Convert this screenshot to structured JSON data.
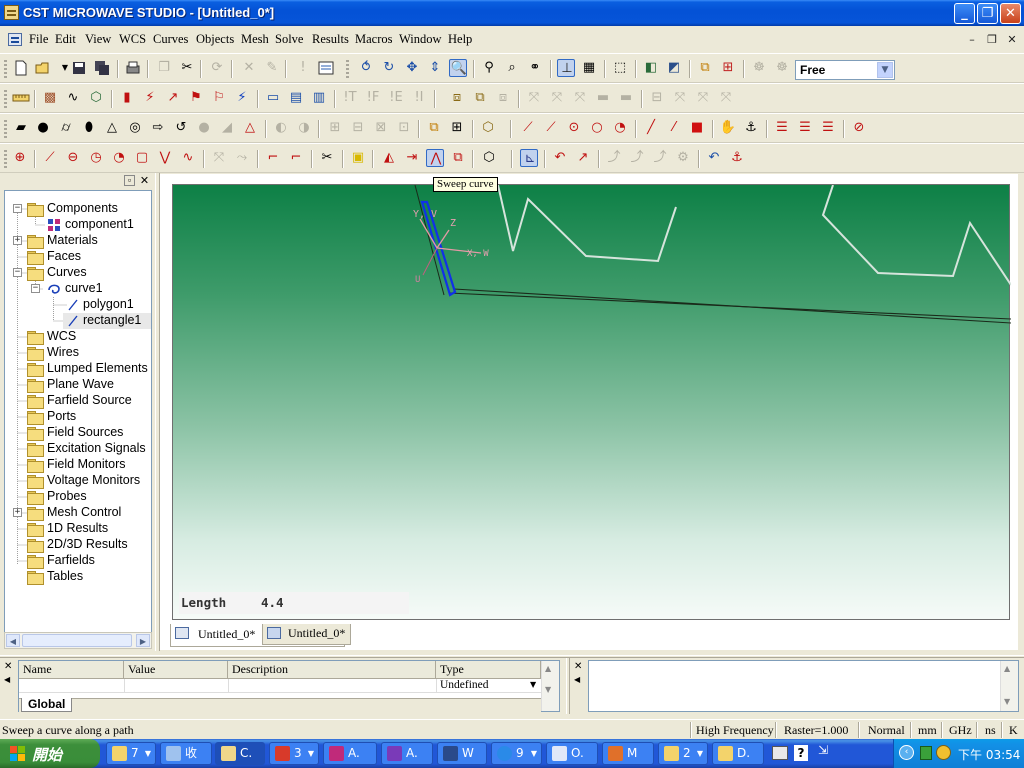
{
  "window": {
    "title": "CST MICROWAVE STUDIO - [Untitled_0*]",
    "buttons": {
      "minimize": "_",
      "maximize": "❐",
      "close": "✕"
    }
  },
  "menu": {
    "items": [
      "File",
      "Edit",
      "View",
      "WCS",
      "Curves",
      "Objects",
      "Mesh",
      "Solve",
      "Results",
      "Macros",
      "Window",
      "Help"
    ],
    "mdi_minimize": "–",
    "mdi_restore": "❐",
    "mdi_close": "✕"
  },
  "toolbar": {
    "view_mode": "Free",
    "tooltip": "Sweep curve"
  },
  "tree": {
    "nodes": [
      {
        "label": "Components",
        "toggle": "−"
      },
      {
        "label": "component1"
      },
      {
        "label": "Materials",
        "toggle": "+"
      },
      {
        "label": "Faces"
      },
      {
        "label": "Curves",
        "toggle": "−"
      },
      {
        "label": "curve1",
        "toggle": "−"
      },
      {
        "label": "polygon1"
      },
      {
        "label": "rectangle1"
      },
      {
        "label": "WCS"
      },
      {
        "label": "Wires"
      },
      {
        "label": "Lumped Elements"
      },
      {
        "label": "Plane Wave"
      },
      {
        "label": "Farfield Source"
      },
      {
        "label": "Ports"
      },
      {
        "label": "Field Sources"
      },
      {
        "label": "Excitation Signals"
      },
      {
        "label": "Field Monitors"
      },
      {
        "label": "Voltage Monitors"
      },
      {
        "label": "Probes"
      },
      {
        "label": "Mesh Control",
        "toggle": "+"
      },
      {
        "label": "1D Results"
      },
      {
        "label": "2D/3D Results"
      },
      {
        "label": "Farfields"
      },
      {
        "label": "Tables"
      }
    ],
    "close": "✕",
    "pin": "▫"
  },
  "viewport": {
    "axis_labels": {
      "vertical": "Y, V",
      "depth": "Z",
      "horizontal": "X, W",
      "u": "U"
    },
    "length_label": "Length",
    "length_value": "4.4"
  },
  "doc_tabs": [
    "Untitled_0*",
    "Untitled_0*"
  ],
  "params": {
    "columns": [
      "Name",
      "Value",
      "Description",
      "Type"
    ],
    "row_type": "Undefined",
    "sheet_tab": "Global"
  },
  "status": {
    "message": "Sweep a curve along a path",
    "mode": "High Frequency",
    "raster": "Raster=1.000",
    "normal": "Normal",
    "unit_length": "mm",
    "unit_freq": "GHz",
    "unit_time": "ns",
    "unit_temp": "K"
  },
  "taskbar": {
    "start": "開始",
    "tasks": [
      "7",
      "收",
      "C.",
      "3",
      "A.",
      "A.",
      "W",
      "9",
      "O.",
      "M",
      "2",
      "D."
    ],
    "clock": "下午 03:54"
  }
}
